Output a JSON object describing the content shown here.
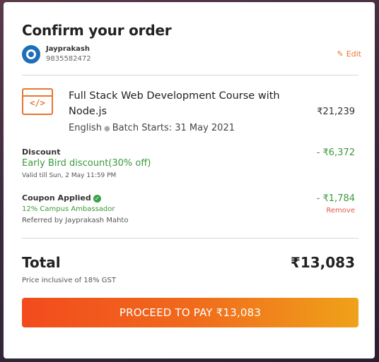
{
  "title": "Confirm your order",
  "user": {
    "name": "Jayprakash",
    "phone": "9835582472",
    "edit_label": "Edit"
  },
  "course": {
    "title": "Full Stack Web Development Course with Node.js",
    "price": "₹21,239",
    "language": "English",
    "batch": "Batch Starts: 31 May 2021",
    "icon_text": "</>"
  },
  "discount": {
    "label": "Discount",
    "name": "Early Bird discount(30% off)",
    "validity": "Valid till Sun, 2 May 11:59 PM",
    "amount": "- ₹6,372"
  },
  "coupon": {
    "label": "Coupon Applied",
    "name": "12% Campus Ambassador",
    "referral": "Referred by Jayprakash Mahto",
    "amount": "- ₹1,784",
    "remove_label": "Remove"
  },
  "total": {
    "label": "Total",
    "value": "₹13,083",
    "gst_note": "Price inclusive of 18% GST"
  },
  "pay_button_label": "PROCEED TO PAY ₹13,083",
  "colors": {
    "accent": "#e8762d",
    "success": "#3a9a3a",
    "danger": "#e0584a",
    "button_start": "#f24b1c",
    "button_end": "#efa21a"
  }
}
